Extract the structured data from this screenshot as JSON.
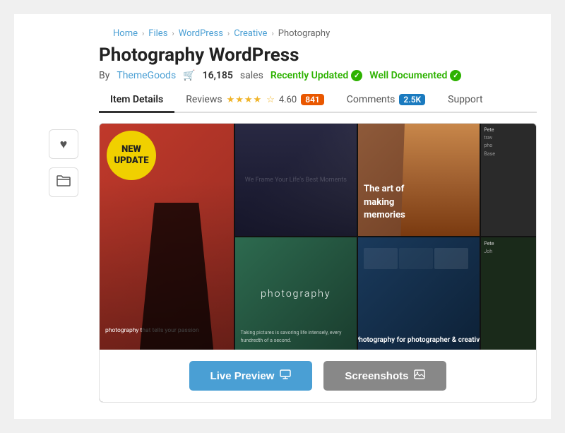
{
  "breadcrumb": {
    "items": [
      "Home",
      "Files",
      "WordPress",
      "Creative",
      "Photography"
    ],
    "separators": [
      "›",
      "›",
      "›",
      "›"
    ]
  },
  "title": "Photography WordPress",
  "author": {
    "label": "By",
    "name": "ThemeGoods",
    "link": "#"
  },
  "sales": {
    "icon": "🛒",
    "count": "16,185",
    "label": "sales"
  },
  "badges": {
    "updated": {
      "text": "Recently Updated",
      "icon": "✓"
    },
    "documented": {
      "text": "Well Documented",
      "icon": "✓"
    }
  },
  "tabs": [
    {
      "label": "Item Details",
      "active": true
    },
    {
      "label": "Reviews",
      "active": false
    },
    {
      "label": "Comments",
      "active": false
    },
    {
      "label": "Support",
      "active": false
    }
  ],
  "reviews": {
    "stars": "★★★★",
    "half": "½",
    "rating": "4.60",
    "count": "841"
  },
  "comments": {
    "count": "2.5K"
  },
  "preview_image": {
    "new_badge": {
      "line1": "NEW",
      "line2": "UPDATE"
    },
    "overlay_text": "photography that tells your passion",
    "frame_text": "We Frame Your Life's Best Moments",
    "center_text": "photography",
    "art_text_line1": "The art of",
    "art_text_line2": "making",
    "art_text_line3": "memories",
    "bottom_text": "Photography  for photographer & creative",
    "taking_text": "Taking pictures is savoring life intensely, every hundredth of a second.",
    "sidebar_items": [
      "Pete",
      "trav",
      "pho",
      "Base",
      "Pete",
      "Joh"
    ]
  },
  "buttons": {
    "live_preview": "Live Preview",
    "screenshots": "Screenshots"
  },
  "sidebar_buttons": {
    "heart": "♥",
    "folder": "📁"
  },
  "colors": {
    "accent_blue": "#4a9fd4",
    "accent_green": "#2db200",
    "btn_gray": "#888888",
    "reviews_badge": "#e95700",
    "comments_badge": "#1a7abf"
  }
}
